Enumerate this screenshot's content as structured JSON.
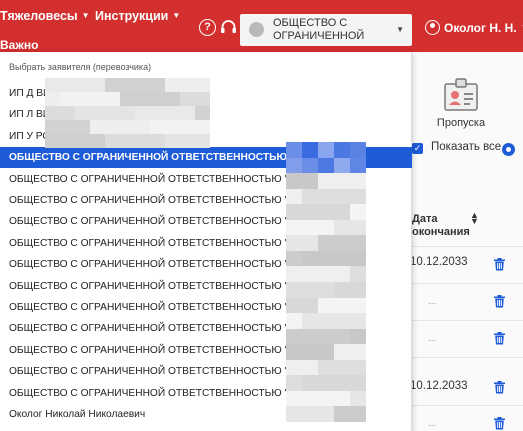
{
  "header": {
    "nav": [
      {
        "label": "Тяжеловесы"
      },
      {
        "label": "Инструкции"
      }
    ],
    "nav_sub": "Важно",
    "help_icon": "?",
    "org_select_value": "ОБЩЕСТВО С ОГРАНИЧЕННОЙ",
    "user_name": "Околог Н. Н."
  },
  "page": {
    "passes_label": "Пропуска",
    "show_all_label": "Показать все",
    "column_header": "Дата окончания",
    "rows": [
      {
        "date": "10.12.2033"
      },
      {
        "date": "..."
      },
      {
        "date": "..."
      },
      {
        "date": ""
      },
      {
        "date": "10.12.2033"
      },
      {
        "date": "..."
      }
    ]
  },
  "dropdown": {
    "header": "Выбрать заявителя (перевозчика)",
    "items": [
      {
        "label": "ИП Д                                                                ВИЧ"
      },
      {
        "label": "ИП Л                                                                ВИЧ"
      },
      {
        "label": "ИП У                                                                РОВИЧ"
      },
      {
        "label": "ОБЩЕСТВО С ОГРАНИЧЕННОЙ ОТВЕТСТВЕННОСТЬЮ \"Л"
      },
      {
        "label": "ОБЩЕСТВО С ОГРАНИЧЕННОЙ ОТВЕТСТВЕННОСТЬЮ \"Б"
      },
      {
        "label": "ОБЩЕСТВО С ОГРАНИЧЕННОЙ ОТВЕТСТВЕННОСТЬЮ \"В                     ОРЫ\""
      },
      {
        "label": "ОБЩЕСТВО С ОГРАНИЧЕННОЙ ОТВЕТСТВЕННОСТЬЮ \"Г"
      },
      {
        "label": "ОБЩЕСТВО С ОГРАНИЧЕННОЙ ОТВЕТСТВЕННОСТЬЮ \"Д"
      },
      {
        "label": "ОБЩЕСТВО С ОГРАНИЧЕННОЙ ОТВЕТСТВЕННОСТЬЮ \"К"
      },
      {
        "label": "ОБЩЕСТВО С ОГРАНИЧЕННОЙ ОТВЕТСТВЕННОСТЬЮ \"Н                     А\""
      },
      {
        "label": "ОБЩЕСТВО С ОГРАНИЧЕННОЙ ОТВЕТСТВЕННОСТЬЮ \"М"
      },
      {
        "label": "ОБЩЕСТВО С ОГРАНИЧЕННОЙ ОТВЕТСТВЕННОСТЬЮ \"Т"
      },
      {
        "label": "ОБЩЕСТВО С ОГРАНИЧЕННОЙ ОТВЕТСТВЕННОСТЬЮ \"Т"
      },
      {
        "label": "ОБЩЕСТВО С ОГРАНИЧЕННОЙ ОТВЕТСТВЕННОСТЬЮ \"Т                      М\""
      },
      {
        "label": "ОБЩЕСТВО С ОГРАНИЧЕННОЙ ОТВЕТСТВЕННОСТЬЮ \"У"
      },
      {
        "label": "Околог Николай Николаевич"
      }
    ],
    "selected_index": 3
  },
  "colors": {
    "header_red": "#d32f2f",
    "selection_blue": "#1e5bd8",
    "trash_blue": "#1e5bd8"
  }
}
